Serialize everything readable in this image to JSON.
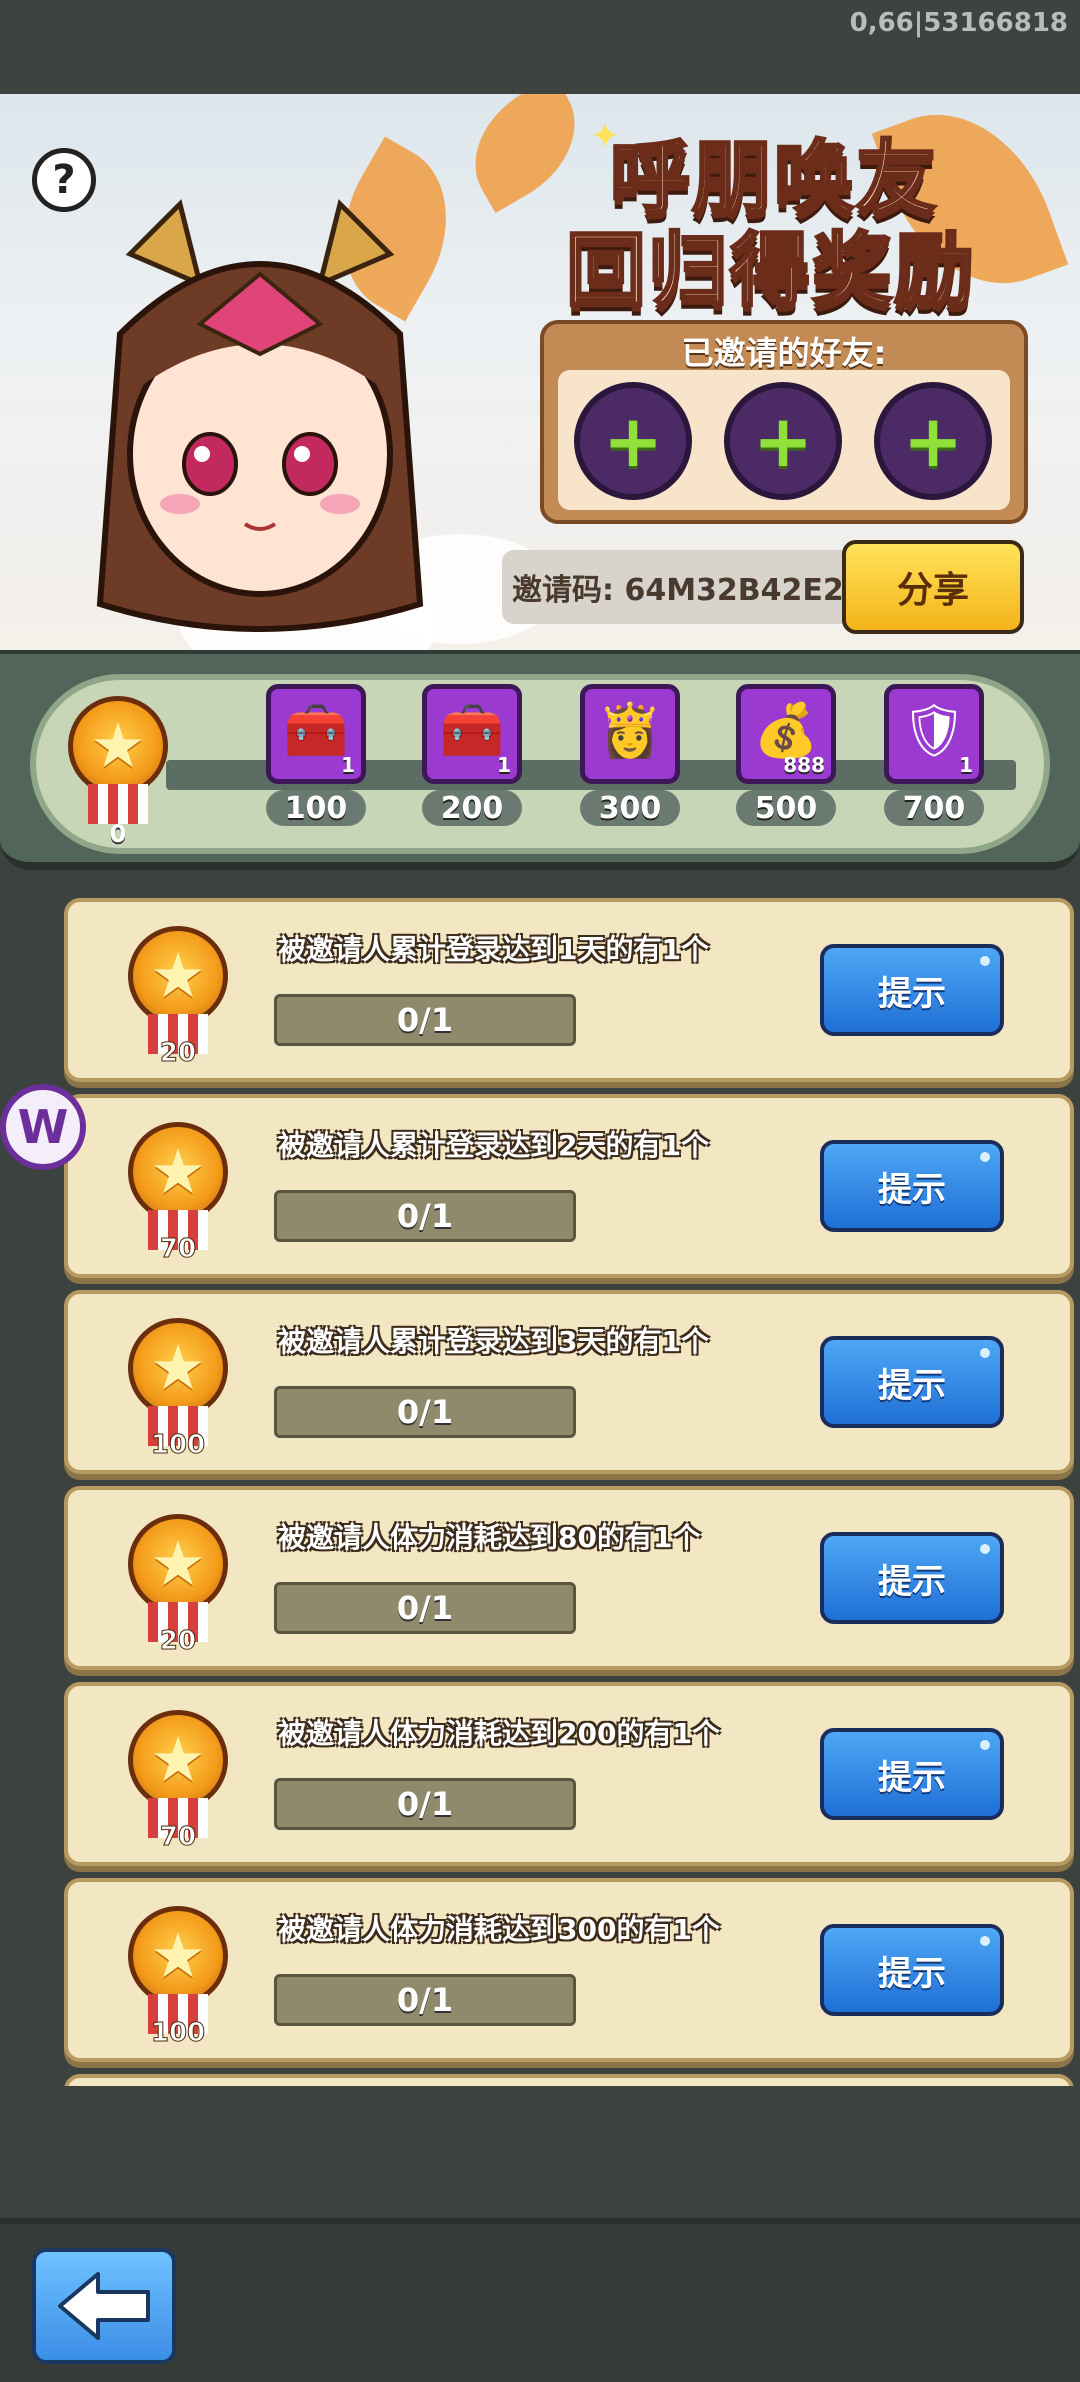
{
  "status": {
    "build_id": "0,66|53166818"
  },
  "banner": {
    "title_line1": "呼朋唤友",
    "title_line2": "回归得奖励",
    "invited_friends_label": "已邀请的好友:",
    "friend_slots": [
      "+",
      "+",
      "+"
    ],
    "invite_code_text": "邀请码: 64M32B42E2",
    "share_label": "分享",
    "help_label": "?"
  },
  "progress_track": {
    "current_points": "0",
    "rewards": [
      {
        "points": "100",
        "icon": "treasure-chest-upgrade-icon",
        "glyph": "🧰",
        "qty": "1"
      },
      {
        "points": "200",
        "icon": "treasure-chest-upgrade-icon",
        "glyph": "🧰",
        "qty": "1"
      },
      {
        "points": "300",
        "icon": "hero-portrait-icon",
        "glyph": "👸",
        "qty": ""
      },
      {
        "points": "500",
        "icon": "gold-ingot-icon",
        "glyph": "💰",
        "qty": "888"
      },
      {
        "points": "700",
        "icon": "golden-armor-icon",
        "glyph": "🛡",
        "qty": "1"
      }
    ]
  },
  "tasks": [
    {
      "reward": "20",
      "description": "被邀请人累计登录达到1天的有1个",
      "progress": "0/1",
      "button": "提示"
    },
    {
      "reward": "70",
      "description": "被邀请人累计登录达到2天的有1个",
      "progress": "0/1",
      "button": "提示"
    },
    {
      "reward": "100",
      "description": "被邀请人累计登录达到3天的有1个",
      "progress": "0/1",
      "button": "提示"
    },
    {
      "reward": "20",
      "description": "被邀请人体力消耗达到80的有1个",
      "progress": "0/1",
      "button": "提示"
    },
    {
      "reward": "70",
      "description": "被邀请人体力消耗达到200的有1个",
      "progress": "0/1",
      "button": "提示"
    },
    {
      "reward": "100",
      "description": "被邀请人体力消耗达到300的有1个",
      "progress": "0/1",
      "button": "提示"
    }
  ],
  "floating_logo": "W",
  "colors": {
    "accent_blue": "#1f6fd6",
    "accent_yellow": "#f4b419",
    "reward_purple": "#9a3ad0"
  }
}
